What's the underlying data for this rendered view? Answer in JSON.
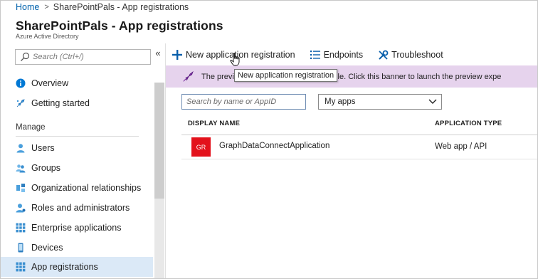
{
  "breadcrumb": {
    "home": "Home",
    "separator": ">",
    "current": "SharePointPals - App registrations"
  },
  "header": {
    "title": "SharePointPals - App registrations",
    "subtitle": "Azure Active Directory"
  },
  "sidebar": {
    "search_placeholder": "Search (Ctrl+/)",
    "collapse_label": "«",
    "items_top": [
      {
        "label": "Overview",
        "icon": "info-icon"
      },
      {
        "label": "Getting started",
        "icon": "rocket-icon"
      }
    ],
    "section_label": "Manage",
    "items_manage": [
      {
        "label": "Users",
        "icon": "user-icon"
      },
      {
        "label": "Groups",
        "icon": "group-icon"
      },
      {
        "label": "Organizational relationships",
        "icon": "org-relationships-icon"
      },
      {
        "label": "Roles and administrators",
        "icon": "roles-icon"
      },
      {
        "label": "Enterprise applications",
        "icon": "apps-grid-icon"
      },
      {
        "label": "Devices",
        "icon": "device-icon"
      },
      {
        "label": "App registrations",
        "icon": "apps-grid-icon",
        "active": true
      }
    ]
  },
  "toolbar": {
    "new_registration": "New application registration",
    "endpoints": "Endpoints",
    "troubleshoot": "Troubleshoot"
  },
  "banner": {
    "text_prefix": "The previe",
    "text_suffix": "ns is available. Click this banner to launch the preview expe"
  },
  "tooltip": {
    "text": "New application registration"
  },
  "filters": {
    "search_placeholder": "Search by name or AppID",
    "scope_selected": "My apps"
  },
  "table": {
    "columns": [
      "DISPLAY NAME",
      "APPLICATION TYPE"
    ],
    "rows": [
      {
        "badge": "GR",
        "name": "GraphDataConnectApplication",
        "type": "Web app / API"
      }
    ]
  },
  "colors": {
    "accent": "#0062ad",
    "banner_bg": "#e6d3ed",
    "active_nav_bg": "#dbe9f7",
    "badge_red": "#e3111b"
  }
}
